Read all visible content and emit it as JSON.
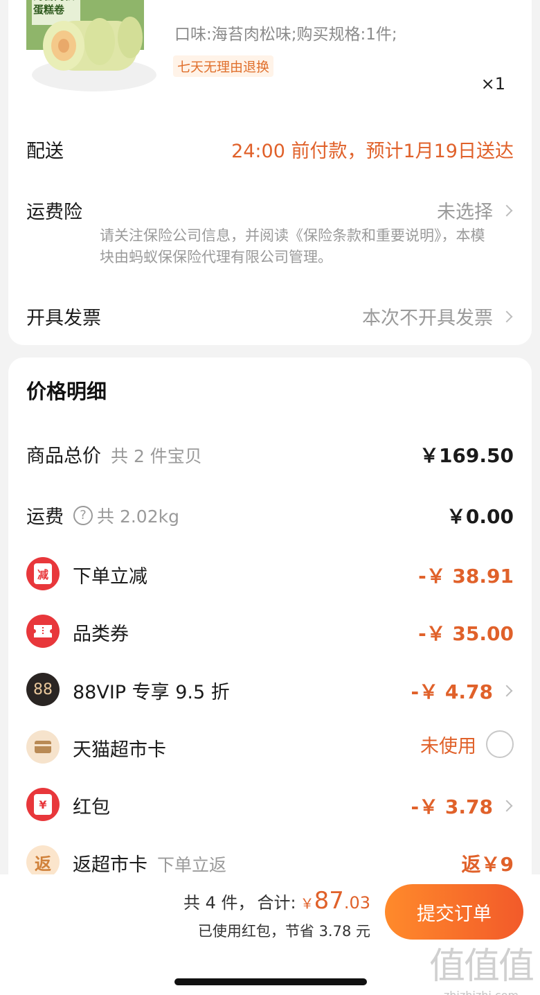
{
  "product": {
    "image_label": "海苔肉松蛋糕卷",
    "spec": "口味:海苔肉松味;购买规格:1件;",
    "tag": "七天无理由退换",
    "qty": "×1"
  },
  "delivery": {
    "label": "配送",
    "value": "24:00 前付款，预计1月19日送达"
  },
  "insurance": {
    "label": "运费险",
    "value": "未选择",
    "note": "请关注保险公司信息，并阅读《保险条款和重要说明》，本模块由蚂蚁保保险代理有限公司管理。"
  },
  "invoice": {
    "label": "开具发票",
    "value": "本次不开具发票"
  },
  "price_detail": {
    "title": "价格明细",
    "goods_total": {
      "label": "商品总价",
      "sub": "共 2 件宝贝",
      "value": "￥169.50"
    },
    "shipping": {
      "label": "运费",
      "sub": "共 2.02kg",
      "value": "￥0.00"
    },
    "items": [
      {
        "icon": "减",
        "label": "下单立减",
        "value": "-￥ 38.91"
      },
      {
        "icon": "",
        "label": "品类券",
        "value": "-￥ 35.00"
      },
      {
        "icon": "88",
        "label": "88VIP 专享 9.5 折",
        "value": "-￥ 4.78"
      },
      {
        "icon": "",
        "label": "天猫超市卡",
        "value": "未使用"
      },
      {
        "icon": "¥",
        "label": "红包",
        "value": "-￥ 3.78"
      },
      {
        "icon": "返",
        "label": "返超市卡",
        "sub": "下单立返",
        "value": "返￥9"
      }
    ]
  },
  "footer": {
    "count": "共 4 件，",
    "total_label": "合计:",
    "currency": "￥",
    "total_int": "87",
    "total_dec": ".03",
    "saved": "已使用红包，节省 3.78 元",
    "submit": "提交订单"
  },
  "watermark": {
    "big": "值值值",
    "small": "zhizhizhi.com"
  },
  "colors": {
    "accent": "#e0612a",
    "submit_start": "#ff8a2b",
    "submit_end": "#f25a2a"
  }
}
